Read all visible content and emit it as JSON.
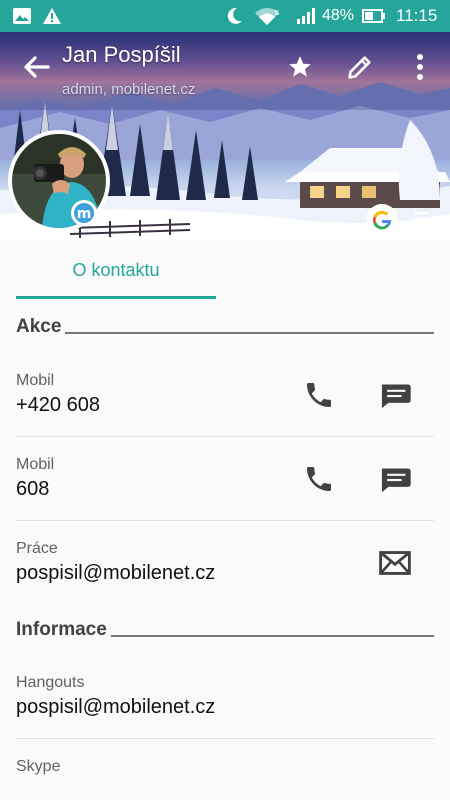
{
  "status_bar": {
    "battery": "48%",
    "time": "11:15"
  },
  "contact": {
    "name": "Jan Pospíšil",
    "account": "admin, mobilenet.cz"
  },
  "tabs": [
    {
      "label": "O kontaktu"
    }
  ],
  "sections": {
    "actions": {
      "title": "Akce"
    },
    "info": {
      "title": "Informace"
    }
  },
  "actions_rows": [
    {
      "label": "Mobil",
      "value": "+420 608"
    },
    {
      "label": "Mobil",
      "value": "608"
    },
    {
      "label": "Práce",
      "value": "pospisil@mobilenet.cz"
    }
  ],
  "info_rows": [
    {
      "label": "Hangouts",
      "value": "pospisil@mobilenet.cz"
    },
    {
      "label": "Skype",
      "value": ""
    }
  ],
  "colors": {
    "accent": "#26a69a",
    "icon": "#424242"
  },
  "icons": {
    "header": [
      "back-arrow-icon",
      "star-icon",
      "edit-icon",
      "more-vert-icon"
    ],
    "row_actions": [
      "phone-icon",
      "message-icon",
      "email-icon"
    ],
    "status": [
      "image-icon",
      "warning-icon",
      "moon-icon",
      "wifi-icon",
      "signal-icon",
      "battery-icon"
    ]
  }
}
